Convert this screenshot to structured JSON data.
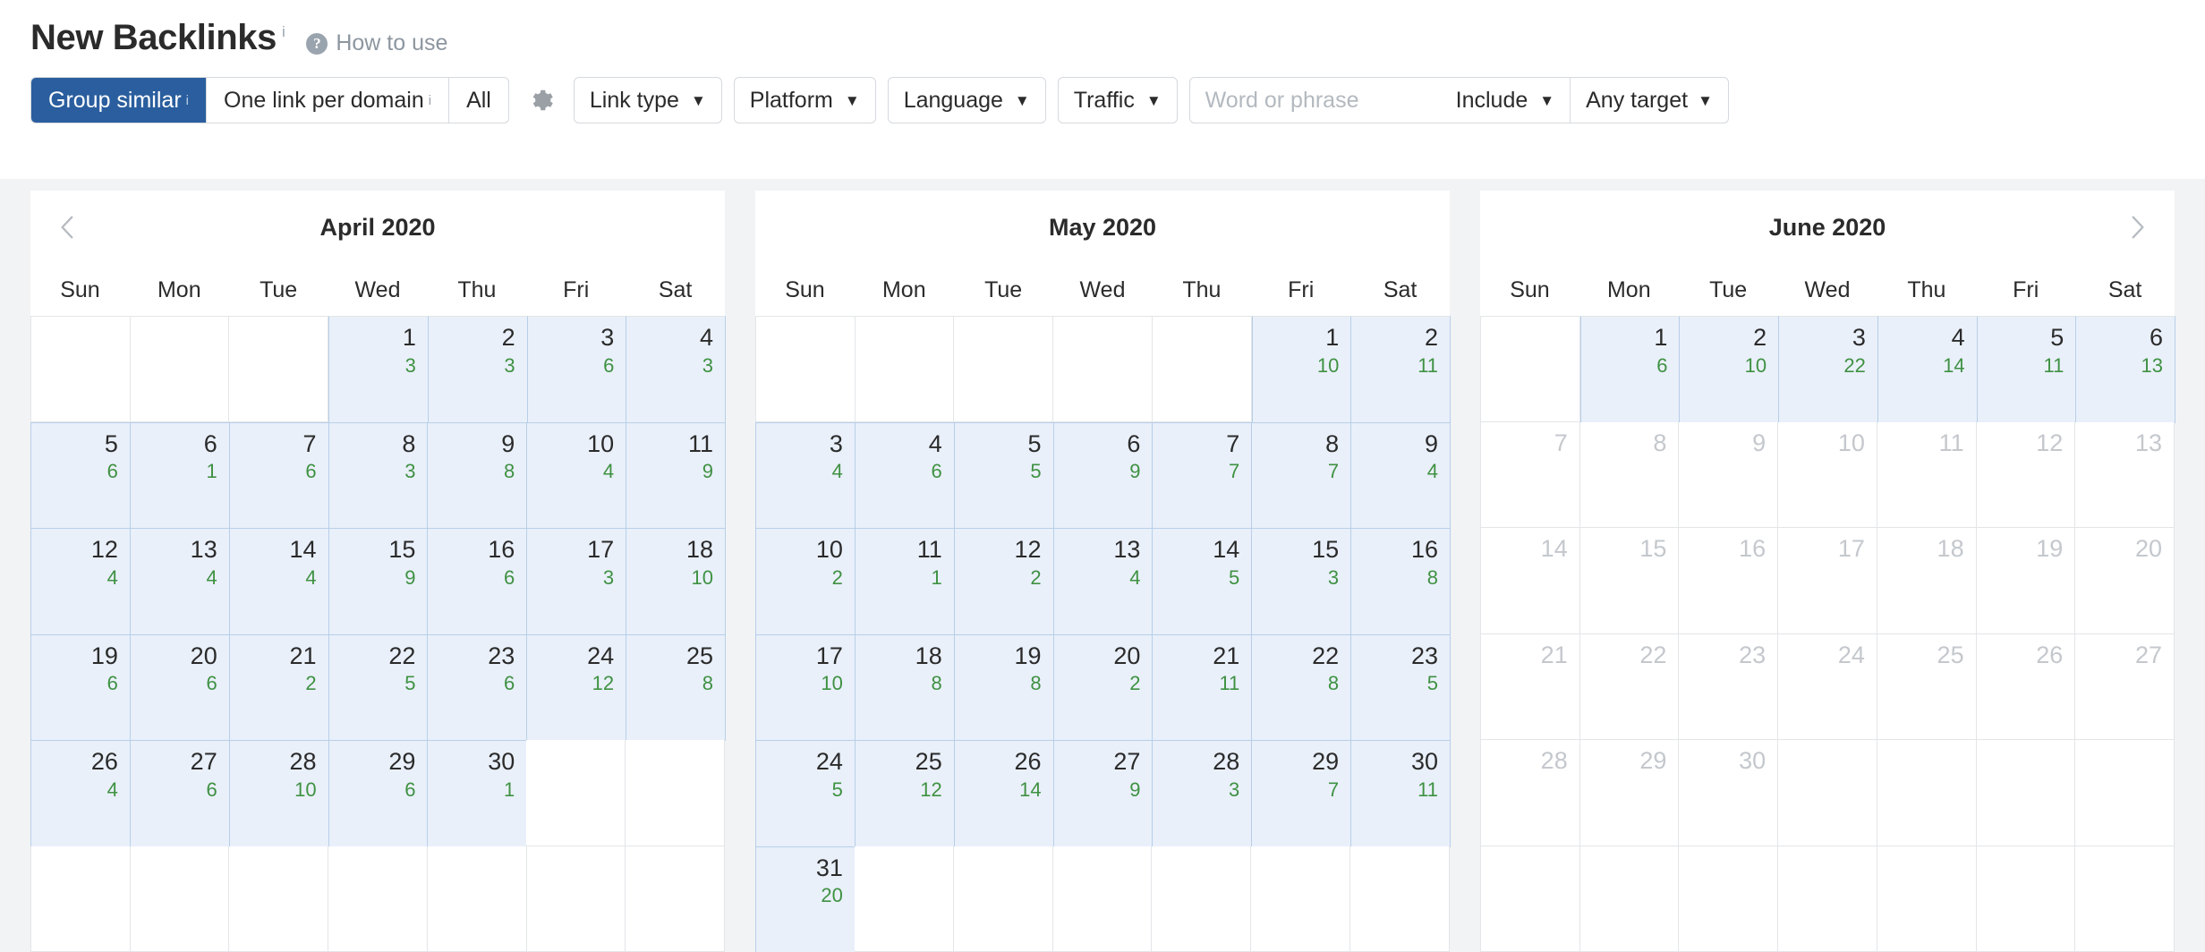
{
  "header": {
    "title": "New Backlinks",
    "title_info_marker": "i",
    "help_icon": "question-mark-icon",
    "help_label": "How to use"
  },
  "toolbar": {
    "segmented": [
      {
        "label": "Group similar",
        "info_marker": "i",
        "active": true
      },
      {
        "label": "One link per domain",
        "info_marker": "i",
        "active": false
      },
      {
        "label": "All",
        "info_marker": "",
        "active": false
      }
    ],
    "settings_icon": "gear-icon",
    "filters": [
      {
        "label": "Link type",
        "caret": "▼"
      },
      {
        "label": "Platform",
        "caret": "▼"
      },
      {
        "label": "Language",
        "caret": "▼"
      },
      {
        "label": "Traffic",
        "caret": "▼"
      }
    ],
    "search": {
      "value": "",
      "placeholder": "Word or phrase",
      "mode_label": "Include",
      "mode_caret": "▼",
      "target_label": "Any target",
      "target_caret": "▼"
    }
  },
  "calendar": {
    "prev_arrow_icon": "chevron-left-icon",
    "next_arrow_icon": "chevron-right-icon",
    "weekday_labels": [
      "Sun",
      "Mon",
      "Tue",
      "Wed",
      "Thu",
      "Fri",
      "Sat"
    ],
    "colors": {
      "selected_background": "#e9f0fa",
      "selected_border": "#b8cfe8",
      "count_text": "#3f9142",
      "day_text": "#2b2b2b",
      "disabled_day_text": "#c4c8cd",
      "accent": "#2a5e9e",
      "panel_gap": "#f2f3f5"
    },
    "months": [
      {
        "title": "April 2020",
        "show_prev": true,
        "show_next": false,
        "weeks": [
          [
            {
              "day": "",
              "count": "",
              "state": "empty"
            },
            {
              "day": "",
              "count": "",
              "state": "empty"
            },
            {
              "day": "",
              "count": "",
              "state": "empty"
            },
            {
              "day": "1",
              "count": "3",
              "state": "selected"
            },
            {
              "day": "2",
              "count": "3",
              "state": "selected"
            },
            {
              "day": "3",
              "count": "6",
              "state": "selected"
            },
            {
              "day": "4",
              "count": "3",
              "state": "selected"
            }
          ],
          [
            {
              "day": "5",
              "count": "6",
              "state": "selected"
            },
            {
              "day": "6",
              "count": "1",
              "state": "selected"
            },
            {
              "day": "7",
              "count": "6",
              "state": "selected"
            },
            {
              "day": "8",
              "count": "3",
              "state": "selected"
            },
            {
              "day": "9",
              "count": "8",
              "state": "selected"
            },
            {
              "day": "10",
              "count": "4",
              "state": "selected"
            },
            {
              "day": "11",
              "count": "9",
              "state": "selected"
            }
          ],
          [
            {
              "day": "12",
              "count": "4",
              "state": "selected"
            },
            {
              "day": "13",
              "count": "4",
              "state": "selected"
            },
            {
              "day": "14",
              "count": "4",
              "state": "selected"
            },
            {
              "day": "15",
              "count": "9",
              "state": "selected"
            },
            {
              "day": "16",
              "count": "6",
              "state": "selected"
            },
            {
              "day": "17",
              "count": "3",
              "state": "selected"
            },
            {
              "day": "18",
              "count": "10",
              "state": "selected"
            }
          ],
          [
            {
              "day": "19",
              "count": "6",
              "state": "selected"
            },
            {
              "day": "20",
              "count": "6",
              "state": "selected"
            },
            {
              "day": "21",
              "count": "2",
              "state": "selected"
            },
            {
              "day": "22",
              "count": "5",
              "state": "selected"
            },
            {
              "day": "23",
              "count": "6",
              "state": "selected"
            },
            {
              "day": "24",
              "count": "12",
              "state": "selected"
            },
            {
              "day": "25",
              "count": "8",
              "state": "selected"
            }
          ],
          [
            {
              "day": "26",
              "count": "4",
              "state": "selected"
            },
            {
              "day": "27",
              "count": "6",
              "state": "selected"
            },
            {
              "day": "28",
              "count": "10",
              "state": "selected"
            },
            {
              "day": "29",
              "count": "6",
              "state": "selected"
            },
            {
              "day": "30",
              "count": "1",
              "state": "selected"
            },
            {
              "day": "",
              "count": "",
              "state": "empty"
            },
            {
              "day": "",
              "count": "",
              "state": "empty"
            }
          ],
          [
            {
              "day": "",
              "count": "",
              "state": "empty"
            },
            {
              "day": "",
              "count": "",
              "state": "empty"
            },
            {
              "day": "",
              "count": "",
              "state": "empty"
            },
            {
              "day": "",
              "count": "",
              "state": "empty"
            },
            {
              "day": "",
              "count": "",
              "state": "empty"
            },
            {
              "day": "",
              "count": "",
              "state": "empty"
            },
            {
              "day": "",
              "count": "",
              "state": "empty"
            }
          ]
        ]
      },
      {
        "title": "May 2020",
        "show_prev": false,
        "show_next": false,
        "weeks": [
          [
            {
              "day": "",
              "count": "",
              "state": "empty"
            },
            {
              "day": "",
              "count": "",
              "state": "empty"
            },
            {
              "day": "",
              "count": "",
              "state": "empty"
            },
            {
              "day": "",
              "count": "",
              "state": "empty"
            },
            {
              "day": "",
              "count": "",
              "state": "empty"
            },
            {
              "day": "1",
              "count": "10",
              "state": "selected"
            },
            {
              "day": "2",
              "count": "11",
              "state": "selected"
            }
          ],
          [
            {
              "day": "3",
              "count": "4",
              "state": "selected"
            },
            {
              "day": "4",
              "count": "6",
              "state": "selected"
            },
            {
              "day": "5",
              "count": "5",
              "state": "selected"
            },
            {
              "day": "6",
              "count": "9",
              "state": "selected"
            },
            {
              "day": "7",
              "count": "7",
              "state": "selected"
            },
            {
              "day": "8",
              "count": "7",
              "state": "selected"
            },
            {
              "day": "9",
              "count": "4",
              "state": "selected"
            }
          ],
          [
            {
              "day": "10",
              "count": "2",
              "state": "selected"
            },
            {
              "day": "11",
              "count": "1",
              "state": "selected"
            },
            {
              "day": "12",
              "count": "2",
              "state": "selected"
            },
            {
              "day": "13",
              "count": "4",
              "state": "selected"
            },
            {
              "day": "14",
              "count": "5",
              "state": "selected"
            },
            {
              "day": "15",
              "count": "3",
              "state": "selected"
            },
            {
              "day": "16",
              "count": "8",
              "state": "selected"
            }
          ],
          [
            {
              "day": "17",
              "count": "10",
              "state": "selected"
            },
            {
              "day": "18",
              "count": "8",
              "state": "selected"
            },
            {
              "day": "19",
              "count": "8",
              "state": "selected"
            },
            {
              "day": "20",
              "count": "2",
              "state": "selected"
            },
            {
              "day": "21",
              "count": "11",
              "state": "selected"
            },
            {
              "day": "22",
              "count": "8",
              "state": "selected"
            },
            {
              "day": "23",
              "count": "5",
              "state": "selected"
            }
          ],
          [
            {
              "day": "24",
              "count": "5",
              "state": "selected"
            },
            {
              "day": "25",
              "count": "12",
              "state": "selected"
            },
            {
              "day": "26",
              "count": "14",
              "state": "selected"
            },
            {
              "day": "27",
              "count": "9",
              "state": "selected"
            },
            {
              "day": "28",
              "count": "3",
              "state": "selected"
            },
            {
              "day": "29",
              "count": "7",
              "state": "selected"
            },
            {
              "day": "30",
              "count": "11",
              "state": "selected"
            }
          ],
          [
            {
              "day": "31",
              "count": "20",
              "state": "selected"
            },
            {
              "day": "",
              "count": "",
              "state": "empty"
            },
            {
              "day": "",
              "count": "",
              "state": "empty"
            },
            {
              "day": "",
              "count": "",
              "state": "empty"
            },
            {
              "day": "",
              "count": "",
              "state": "empty"
            },
            {
              "day": "",
              "count": "",
              "state": "empty"
            },
            {
              "day": "",
              "count": "",
              "state": "empty"
            }
          ]
        ]
      },
      {
        "title": "June 2020",
        "show_prev": false,
        "show_next": true,
        "weeks": [
          [
            {
              "day": "",
              "count": "",
              "state": "empty"
            },
            {
              "day": "1",
              "count": "6",
              "state": "selected"
            },
            {
              "day": "2",
              "count": "10",
              "state": "selected"
            },
            {
              "day": "3",
              "count": "22",
              "state": "selected"
            },
            {
              "day": "4",
              "count": "14",
              "state": "selected"
            },
            {
              "day": "5",
              "count": "11",
              "state": "selected"
            },
            {
              "day": "6",
              "count": "13",
              "state": "selected"
            }
          ],
          [
            {
              "day": "7",
              "count": "",
              "state": "disabled"
            },
            {
              "day": "8",
              "count": "",
              "state": "disabled"
            },
            {
              "day": "9",
              "count": "",
              "state": "disabled"
            },
            {
              "day": "10",
              "count": "",
              "state": "disabled"
            },
            {
              "day": "11",
              "count": "",
              "state": "disabled"
            },
            {
              "day": "12",
              "count": "",
              "state": "disabled"
            },
            {
              "day": "13",
              "count": "",
              "state": "disabled"
            }
          ],
          [
            {
              "day": "14",
              "count": "",
              "state": "disabled"
            },
            {
              "day": "15",
              "count": "",
              "state": "disabled"
            },
            {
              "day": "16",
              "count": "",
              "state": "disabled"
            },
            {
              "day": "17",
              "count": "",
              "state": "disabled"
            },
            {
              "day": "18",
              "count": "",
              "state": "disabled"
            },
            {
              "day": "19",
              "count": "",
              "state": "disabled"
            },
            {
              "day": "20",
              "count": "",
              "state": "disabled"
            }
          ],
          [
            {
              "day": "21",
              "count": "",
              "state": "disabled"
            },
            {
              "day": "22",
              "count": "",
              "state": "disabled"
            },
            {
              "day": "23",
              "count": "",
              "state": "disabled"
            },
            {
              "day": "24",
              "count": "",
              "state": "disabled"
            },
            {
              "day": "25",
              "count": "",
              "state": "disabled"
            },
            {
              "day": "26",
              "count": "",
              "state": "disabled"
            },
            {
              "day": "27",
              "count": "",
              "state": "disabled"
            }
          ],
          [
            {
              "day": "28",
              "count": "",
              "state": "disabled"
            },
            {
              "day": "29",
              "count": "",
              "state": "disabled"
            },
            {
              "day": "30",
              "count": "",
              "state": "disabled"
            },
            {
              "day": "",
              "count": "",
              "state": "empty"
            },
            {
              "day": "",
              "count": "",
              "state": "empty"
            },
            {
              "day": "",
              "count": "",
              "state": "empty"
            },
            {
              "day": "",
              "count": "",
              "state": "empty"
            }
          ],
          [
            {
              "day": "",
              "count": "",
              "state": "empty"
            },
            {
              "day": "",
              "count": "",
              "state": "empty"
            },
            {
              "day": "",
              "count": "",
              "state": "empty"
            },
            {
              "day": "",
              "count": "",
              "state": "empty"
            },
            {
              "day": "",
              "count": "",
              "state": "empty"
            },
            {
              "day": "",
              "count": "",
              "state": "empty"
            },
            {
              "day": "",
              "count": "",
              "state": "empty"
            }
          ]
        ]
      }
    ]
  }
}
